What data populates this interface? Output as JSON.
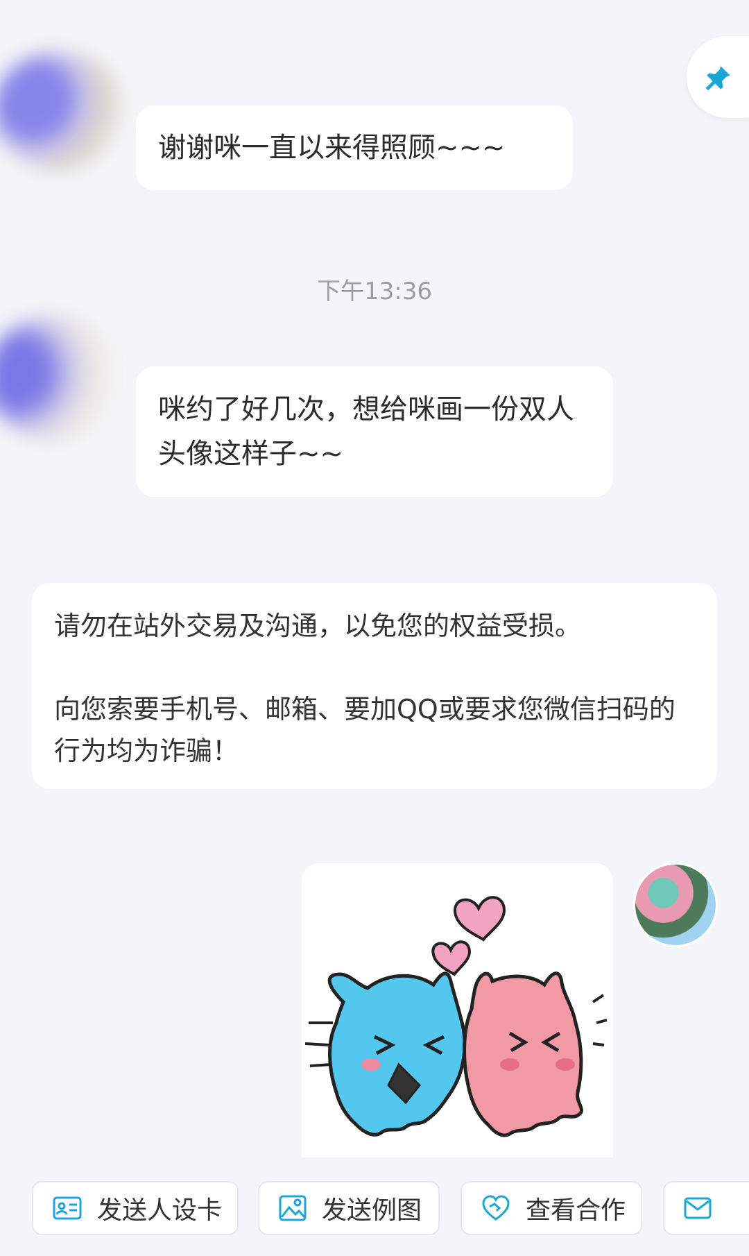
{
  "messages": [
    {
      "text": "谢谢咪一直以来得照顾~~~"
    },
    {
      "text": "咪约了好几次，想给咪画一份双人头像这样子~~"
    }
  ],
  "timestamp": "下午13:36",
  "notice": {
    "line1": "请勿在站外交易及沟通，以免您的权益受损。",
    "line2": "向您索要手机号、邮箱、要加QQ或要求您微信扫码的行为均为诈骗！"
  },
  "toolbar": {
    "buttons": [
      {
        "label": "发送人设卡",
        "icon": "id-card-icon"
      },
      {
        "label": "发送例图",
        "icon": "image-icon"
      },
      {
        "label": "查看合作",
        "icon": "handshake-heart-icon"
      },
      {
        "label": "",
        "icon": "mail-icon"
      }
    ]
  },
  "colors": {
    "accent": "#1aa7d8",
    "background": "#f4f5f8",
    "bubble": "#ffffff"
  }
}
